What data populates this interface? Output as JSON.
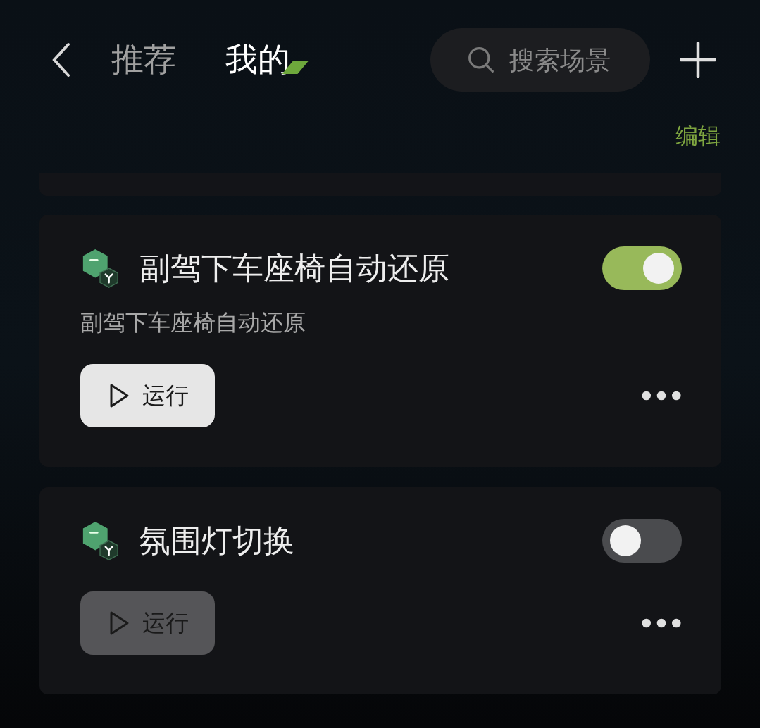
{
  "header": {
    "tabs": [
      {
        "label": "推荐",
        "selected": false
      },
      {
        "label": "我的",
        "selected": true
      }
    ],
    "search": {
      "placeholder": "搜索场景"
    }
  },
  "edit_label": "编辑",
  "scenes": [
    {
      "title": "副驾下车座椅自动还原",
      "description": "副驾下车座椅自动还原",
      "enabled": true,
      "run_label": "运行"
    },
    {
      "title": "氛围灯切换",
      "enabled": false,
      "run_label": "运行"
    }
  ]
}
